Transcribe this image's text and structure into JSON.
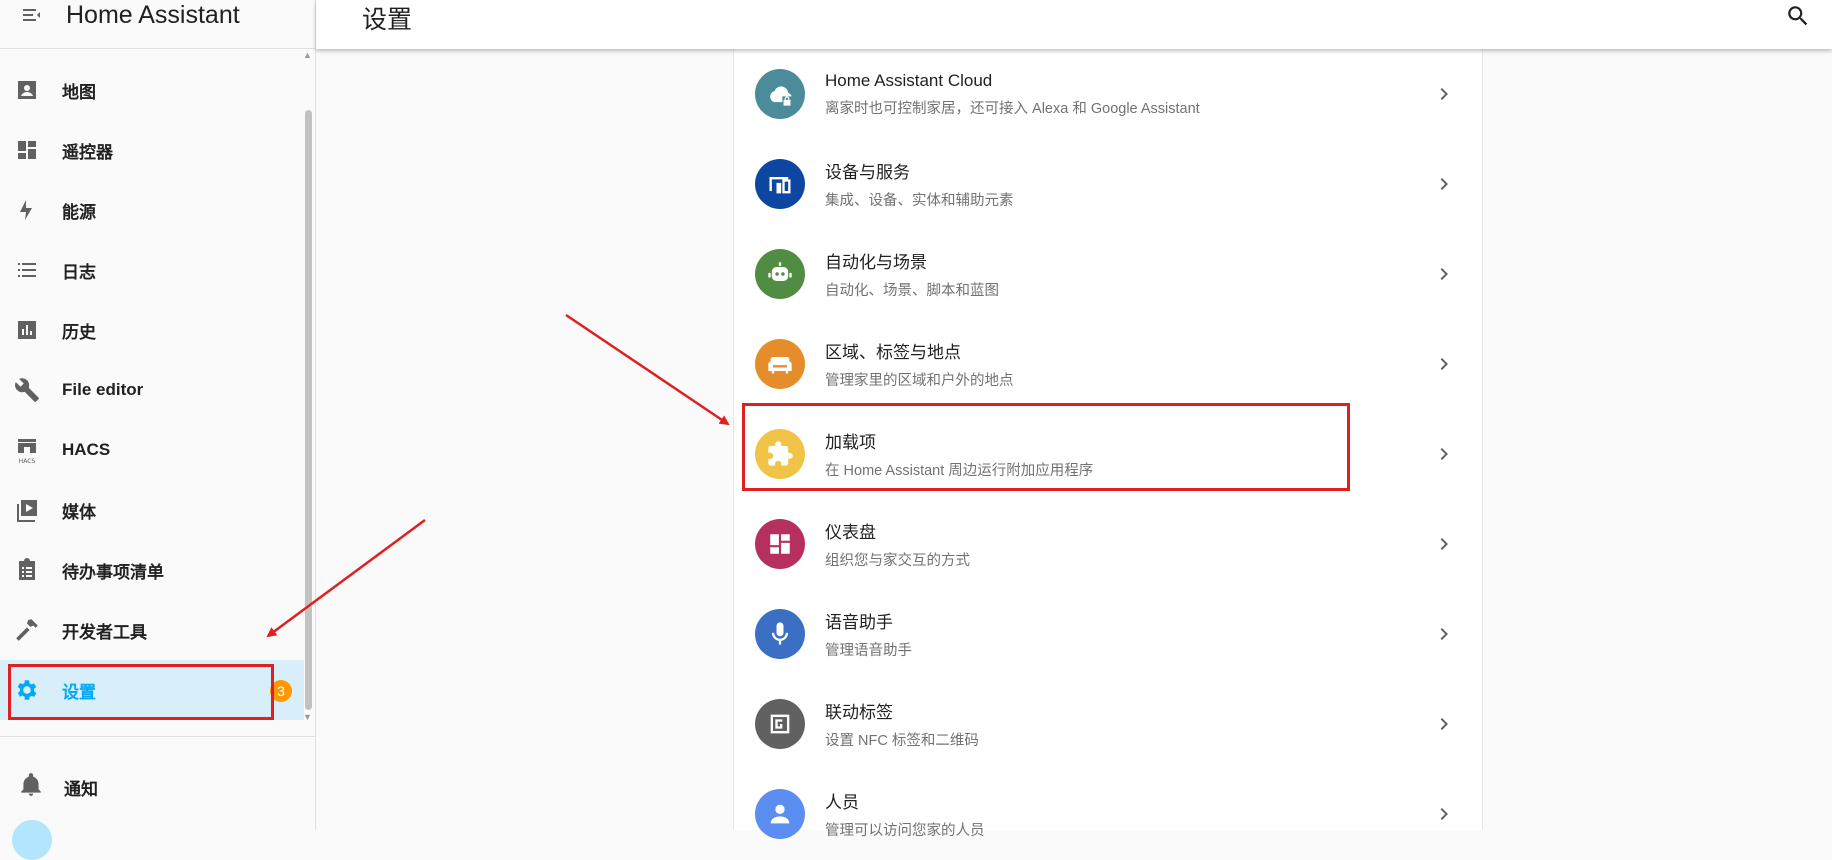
{
  "app": {
    "title": "Home Assistant"
  },
  "page": {
    "title": "设置"
  },
  "sidebar": {
    "items": [
      {
        "label": "地图",
        "icon": "map-account-icon"
      },
      {
        "label": "遥控器",
        "icon": "dashboard-icon"
      },
      {
        "label": "能源",
        "icon": "lightning-bolt-icon"
      },
      {
        "label": "日志",
        "icon": "list-icon"
      },
      {
        "label": "历史",
        "icon": "chart-box-icon"
      },
      {
        "label": "File editor",
        "icon": "wrench-icon"
      },
      {
        "label": "HACS",
        "icon": "hacs-icon"
      },
      {
        "label": "媒体",
        "icon": "play-box-multiple-icon"
      },
      {
        "label": "待办事项清单",
        "icon": "clipboard-list-icon"
      },
      {
        "label": "开发者工具",
        "icon": "hammer-icon"
      },
      {
        "label": "设置",
        "icon": "gear-icon",
        "badge": "3",
        "active": true
      }
    ],
    "notifications_label": "通知"
  },
  "settings": {
    "rows": [
      {
        "title": "Home Assistant Cloud",
        "subtitle": "离家时也可控制家居，还可接入 Alexa 和 Google Assistant",
        "icon": "cloud-lock-icon",
        "color": "#4c8b9a"
      },
      {
        "title": "设备与服务",
        "subtitle": "集成、设备、实体和辅助元素",
        "icon": "devices-icon",
        "color": "#0d47a1"
      },
      {
        "title": "自动化与场景",
        "subtitle": "自动化、场景、脚本和蓝图",
        "icon": "robot-icon",
        "color": "#518c43"
      },
      {
        "title": "区域、标签与地点",
        "subtitle": "管理家里的区域和户外的地点",
        "icon": "sofa-icon",
        "color": "#e68d2b"
      },
      {
        "title": "加载项",
        "subtitle": "在 Home Assistant 周边运行附加应用程序",
        "icon": "puzzle-icon",
        "color": "#f1c447"
      },
      {
        "title": "仪表盘",
        "subtitle": "组织您与家交互的方式",
        "icon": "dashboard-icon",
        "color": "#b5305e"
      },
      {
        "title": "语音助手",
        "subtitle": "管理语音助手",
        "icon": "microphone-icon",
        "color": "#3a6fc4"
      },
      {
        "title": "联动标签",
        "subtitle": "设置 NFC 标签和二维码",
        "icon": "nfc-icon",
        "color": "#616161"
      },
      {
        "title": "人员",
        "subtitle": "管理可以访问您家的人员",
        "icon": "account-icon",
        "color": "#5c8df0"
      }
    ]
  },
  "colors": {
    "accent": "#03a9f4",
    "active_bg": "#d8eefa",
    "badge": "#ff9800",
    "annotation": "#e02020"
  }
}
